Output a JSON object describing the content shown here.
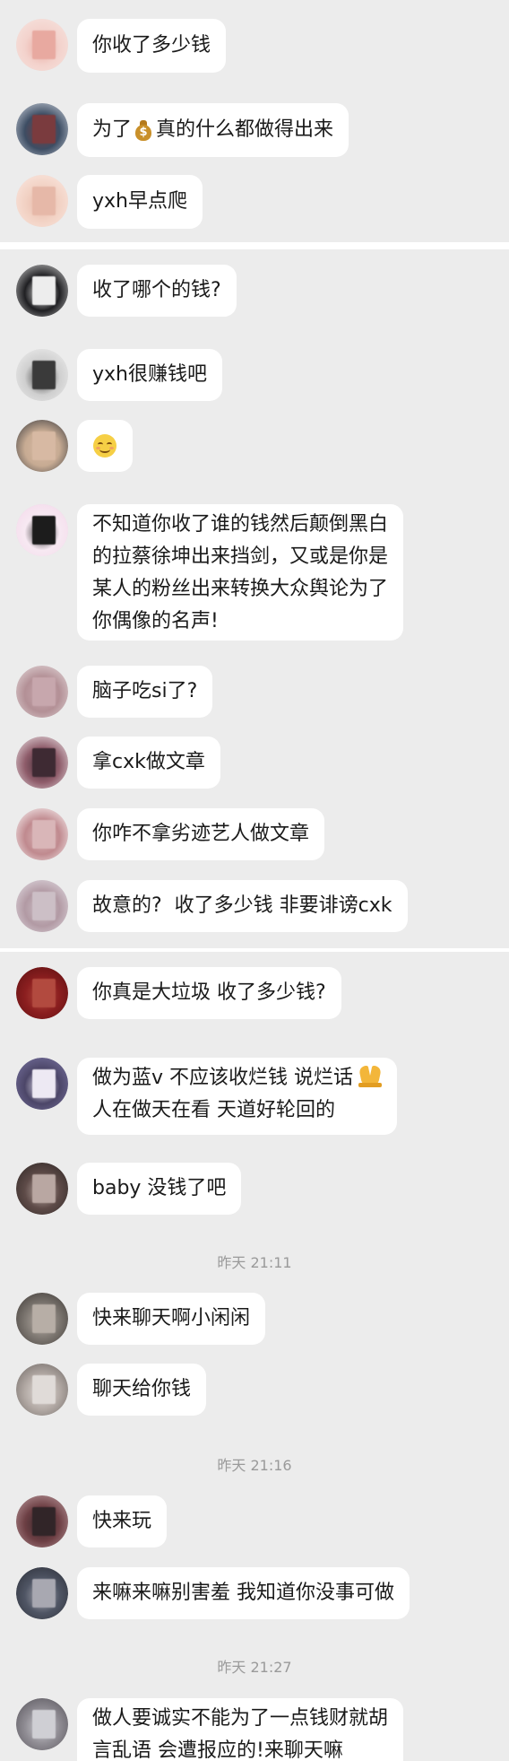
{
  "messages": [
    {
      "id": "m1",
      "text": "你收了多少钱",
      "avatar_colors": [
        "#f3d2cc",
        "#e8a9a0",
        "#f7e6e1"
      ]
    },
    {
      "id": "m2",
      "text_before": "为了",
      "icon": "money-bag-icon",
      "text_after": "真的什么都做得出来",
      "avatar_colors": [
        "#3d4d63",
        "#7a3b3e",
        "#d8dde6"
      ]
    },
    {
      "id": "m3",
      "text": "yxh早点爬",
      "avatar_colors": [
        "#f2d2c4",
        "#e6b8a8",
        "#fbe9e3"
      ]
    },
    {
      "id": "m4",
      "text": "收了哪个的钱?",
      "avatar_colors": [
        "#1f1f22",
        "#ededed",
        "#d9d9d9"
      ]
    },
    {
      "id": "m5",
      "text": "yxh很赚钱吧",
      "avatar_colors": [
        "#cfcfcf",
        "#3a3a3a",
        "#f1f1f1"
      ]
    },
    {
      "id": "m6",
      "icon": "smile-emoji-icon",
      "avatar_colors": [
        "#c7ab93",
        "#d7b9a3",
        "#2f3238"
      ]
    },
    {
      "id": "m7",
      "lines": [
        "不知道你收了谁的钱然后颠倒黑白",
        "的拉蔡徐坤出来挡剑，又或是你是",
        "某人的粉丝出来转换大众舆论为了",
        "你偶像的名声!"
      ],
      "avatar_colors": [
        "#f7e9f2",
        "#1c1c1c",
        "#f3d7ea"
      ]
    },
    {
      "id": "m8",
      "text": "脑子吃si了?",
      "avatar_colors": [
        "#b39096",
        "#c7a7ad",
        "#e8dfe0"
      ]
    },
    {
      "id": "m9",
      "text": "拿cxk做文章",
      "avatar_colors": [
        "#8f5d6b",
        "#3e2a33",
        "#f4eef0"
      ]
    },
    {
      "id": "m10",
      "text": "你咋不拿劣迹艺人做文章",
      "avatar_colors": [
        "#c08a8f",
        "#d9b6b8",
        "#ffffff"
      ]
    },
    {
      "id": "m11",
      "text": "故意的?  收了多少钱 非要诽谤cxk",
      "avatar_colors": [
        "#b29aa4",
        "#ccbfc6",
        "#e6e2e8"
      ]
    },
    {
      "id": "m12",
      "text": "你真是大垃圾 收了多少钱?",
      "avatar_colors": [
        "#8b1e1f",
        "#b24a3f",
        "#5a1011"
      ]
    },
    {
      "id": "m13",
      "lines": [
        "做为蓝v 不应该收烂钱 说烂话",
        "人在做天在看 天道好轮回的"
      ],
      "icon": "pray-icon",
      "avatar_colors": [
        "#4c4668",
        "#ede9f3",
        "#7c77a6"
      ]
    },
    {
      "id": "m14",
      "text": "baby 没钱了吧",
      "avatar_colors": [
        "#5e4b48",
        "#b9a7a2",
        "#2c2523"
      ]
    },
    {
      "id": "m15",
      "text": "快来聊天啊小闲闲",
      "avatar_colors": [
        "#7d7771",
        "#b7aea6",
        "#3b3633"
      ]
    },
    {
      "id": "m16",
      "text": "聊天给你钱",
      "avatar_colors": [
        "#b3aaa5",
        "#e0dbd8",
        "#6b6461"
      ]
    },
    {
      "id": "m17",
      "text": "快来玩",
      "avatar_colors": [
        "#6d3f44",
        "#312528",
        "#c3a3a6"
      ]
    },
    {
      "id": "m18",
      "text": "来嘛来嘛别害羞 我知道你没事可做",
      "avatar_colors": [
        "#4f5564",
        "#a8a8b1",
        "#2a2d36"
      ]
    },
    {
      "id": "m19",
      "lines": [
        "做人要诚实不能为了一点钱财就胡",
        "言乱语 会遭报应的!来聊天嘛"
      ],
      "avatar_colors": [
        "#8f8c93",
        "#cfcfd4",
        "#545158"
      ]
    }
  ],
  "timestamps": {
    "t1": "昨天 21:11",
    "t2": "昨天 21:16",
    "t3": "昨天 21:27"
  },
  "colors": {
    "panel_bg": "#ececec",
    "divider": "#ffffff",
    "bubble_bg": "#ffffff",
    "text": "#1a1a1a",
    "timestamp": "#9a9a9a"
  }
}
